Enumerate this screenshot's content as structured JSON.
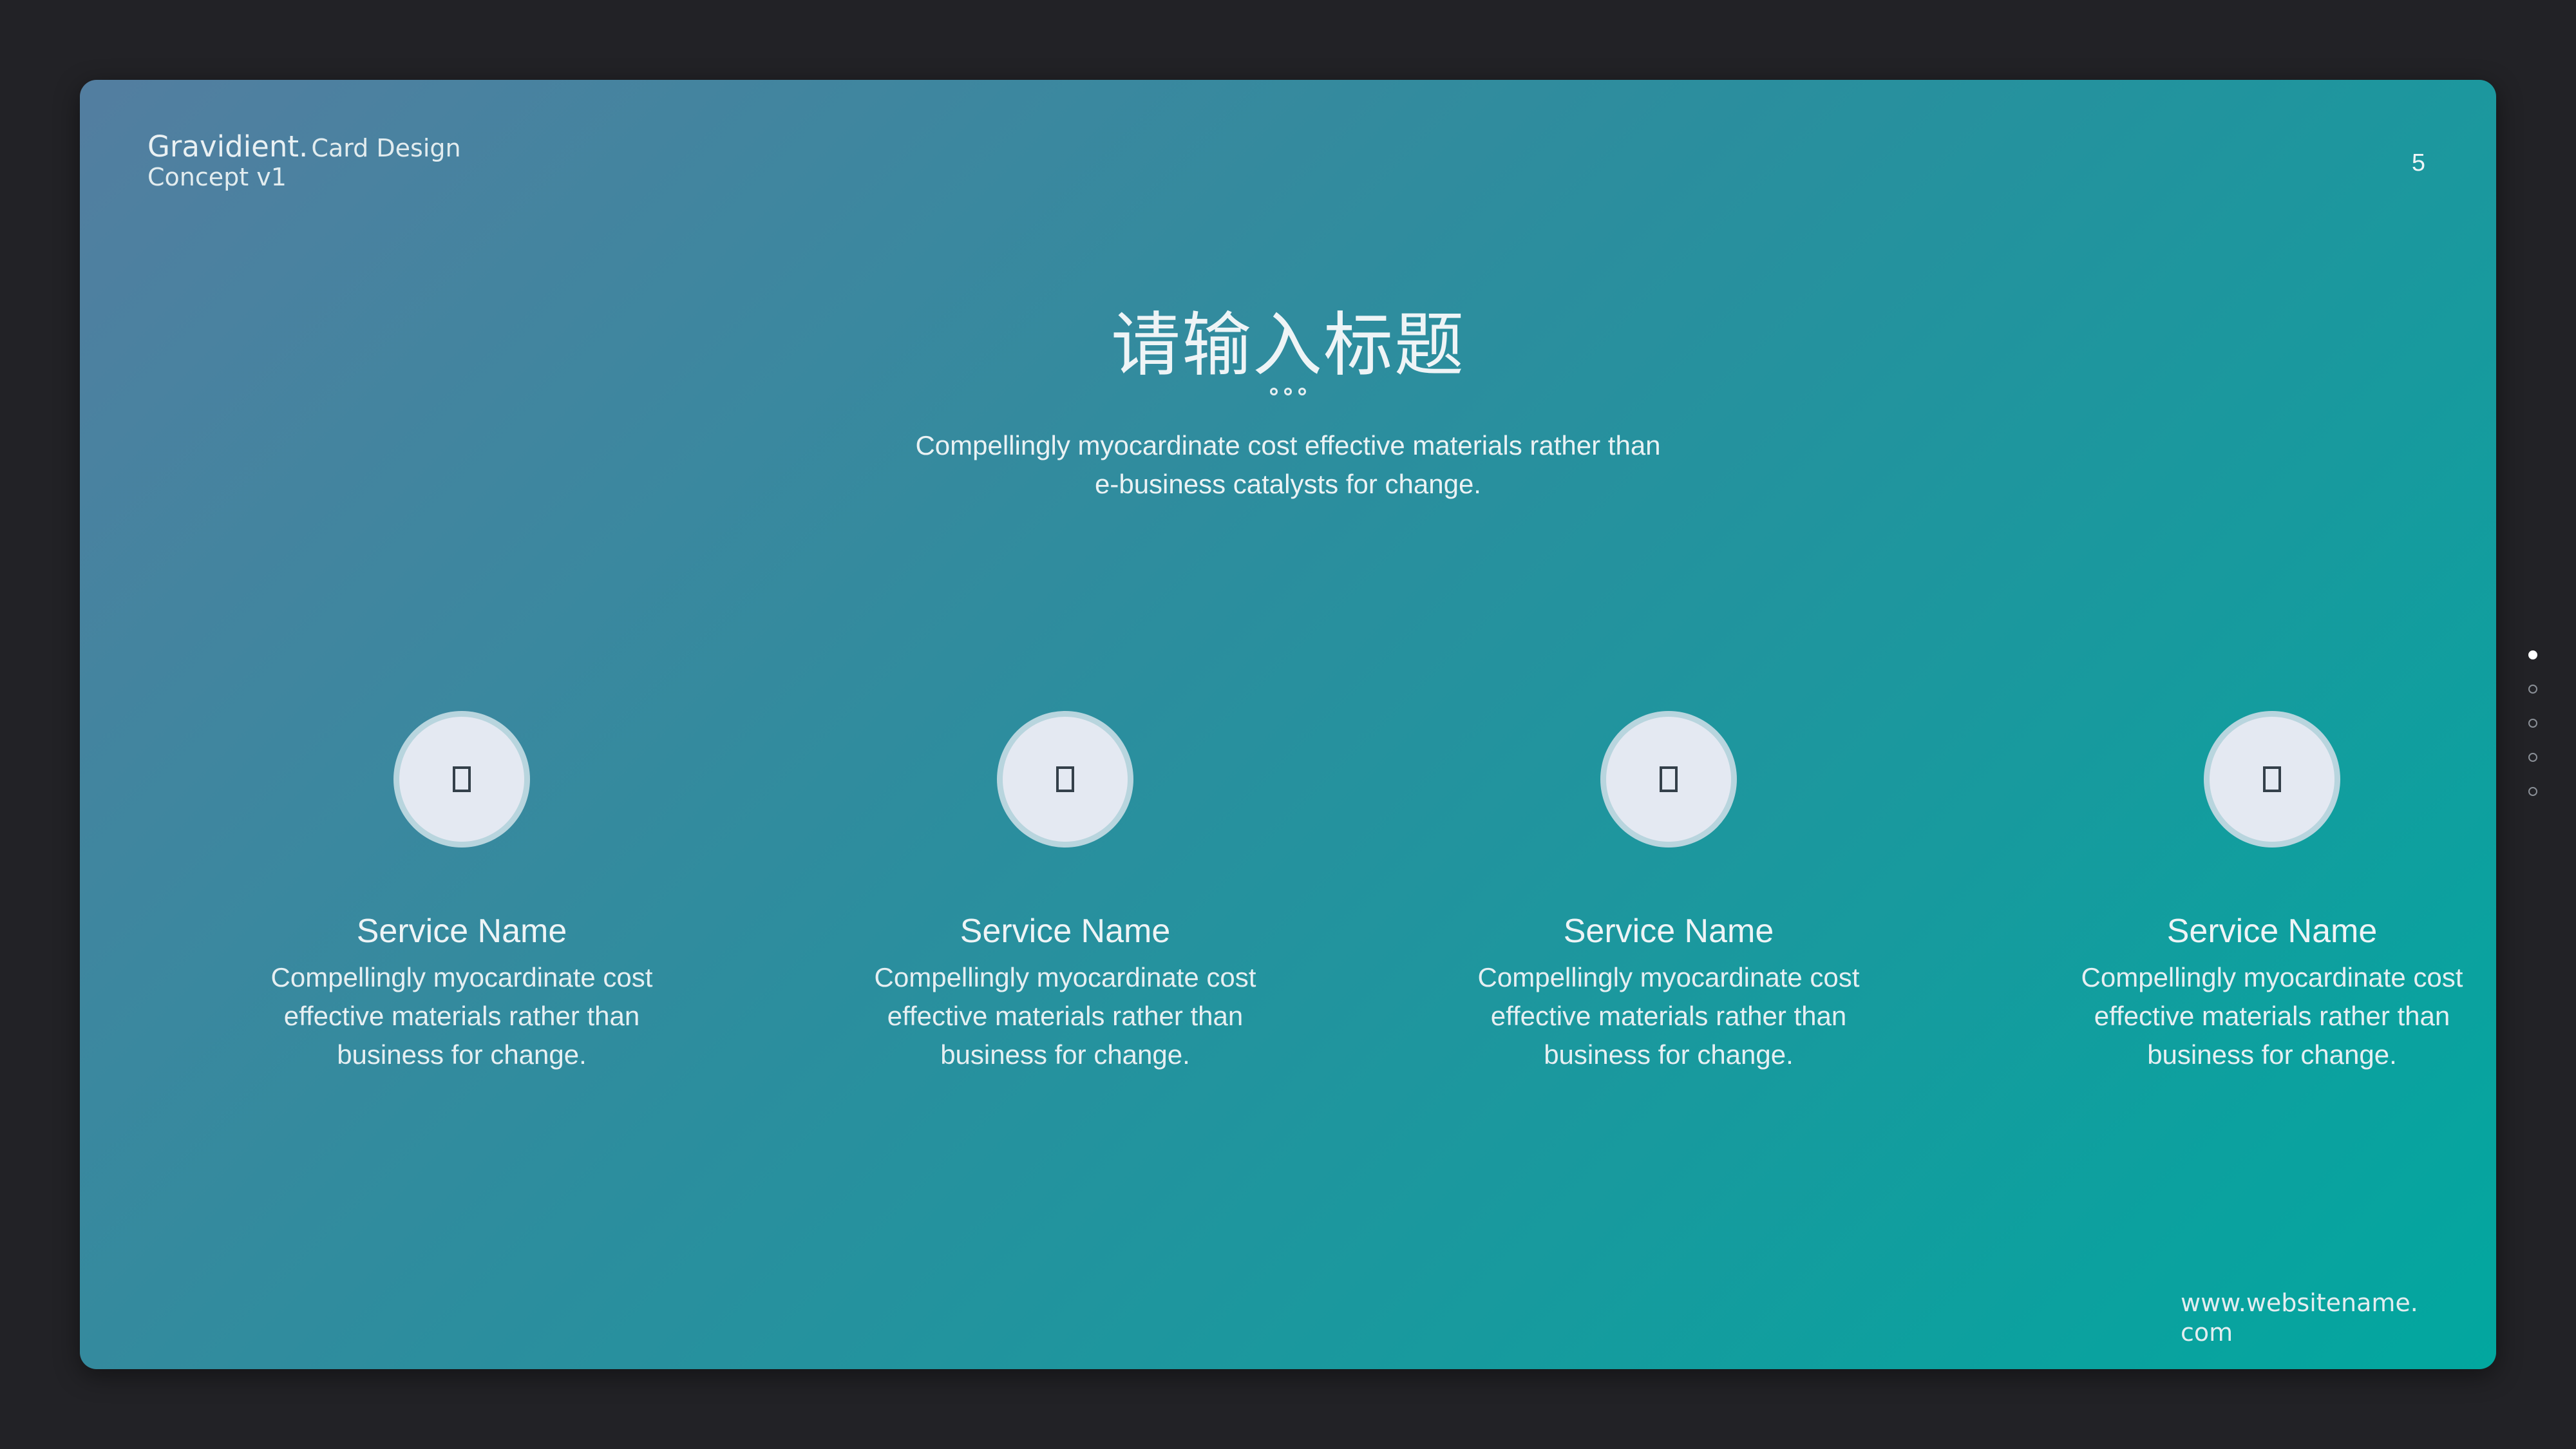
{
  "header": {
    "brand_name": "Gravidient.",
    "brand_sub": "Card Design",
    "brand_line2": "Concept v1",
    "page_number": "5"
  },
  "main": {
    "title": "请输入标题",
    "subtitle_line1": "Compellingly myocardinate cost effective materials rather than",
    "subtitle_line2": "e-business catalysts for change."
  },
  "cards": [
    {
      "icon": "square-icon",
      "name": "Service Name",
      "desc_line1": "Compellingly myocardinate cost",
      "desc_line2": "effective materials rather than",
      "desc_line3": "business for change."
    },
    {
      "icon": "square-icon",
      "name": "Service Name",
      "desc_line1": "Compellingly myocardinate cost",
      "desc_line2": "effective materials rather than",
      "desc_line3": "business for change."
    },
    {
      "icon": "square-icon",
      "name": "Service Name",
      "desc_line1": "Compellingly myocardinate cost",
      "desc_line2": "effective materials rather than",
      "desc_line3": "business for change."
    },
    {
      "icon": "square-icon",
      "name": "Service Name",
      "desc_line1": "Compellingly myocardinate cost",
      "desc_line2": "effective materials rather than",
      "desc_line3": "business for change."
    }
  ],
  "footer": {
    "website_line1": "www.websitename.",
    "website_line2": "com"
  },
  "pagination": {
    "total": 5,
    "active_index": 0
  },
  "colors": {
    "background": "#222226",
    "gradient_start": "#537ea0",
    "gradient_end": "#02a79f",
    "circle_fill": "#e4e9f2"
  }
}
